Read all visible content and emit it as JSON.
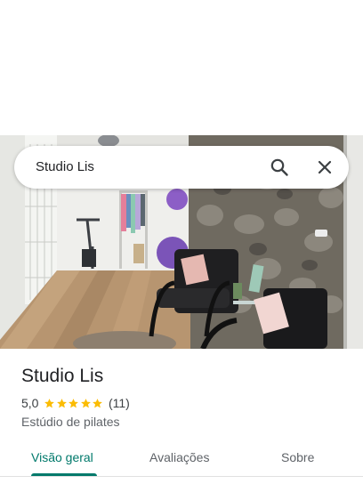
{
  "search": {
    "query": "Studio Lis",
    "search_icon": "search-icon",
    "close_icon": "close-icon"
  },
  "photo": {
    "description_icon": "place-photo"
  },
  "place": {
    "name": "Studio Lis",
    "rating": "5,0",
    "stars": 5,
    "star_color": "#fbbc04",
    "review_count": "(11)",
    "category": "Estúdio de pilates"
  },
  "tabs": [
    {
      "label": "Visão geral",
      "active": true
    },
    {
      "label": "Avaliações",
      "active": false
    },
    {
      "label": "Sobre",
      "active": false
    }
  ],
  "colors": {
    "accent": "#00796b"
  }
}
